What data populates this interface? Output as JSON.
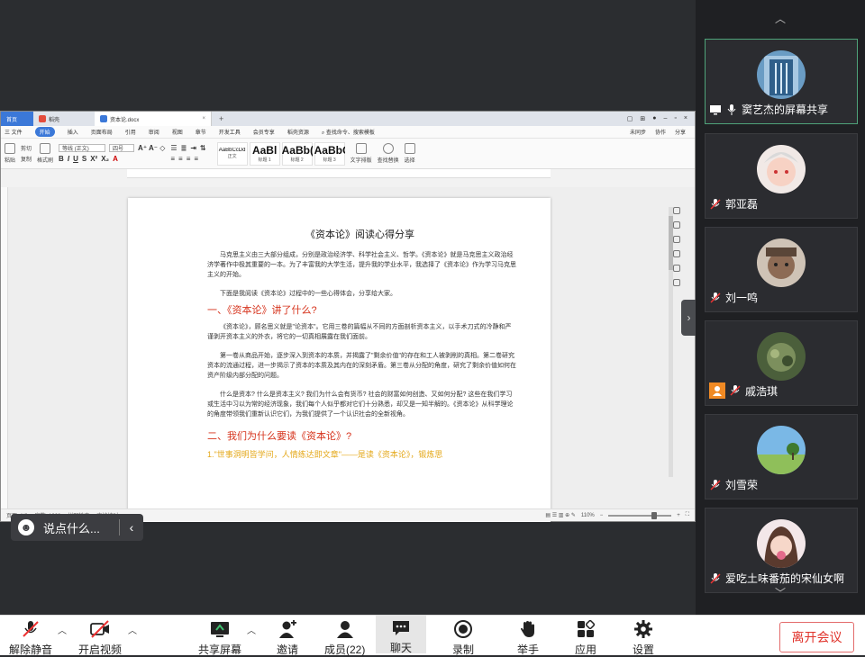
{
  "wps": {
    "tab_home": "首页",
    "tab_docer": "稻壳",
    "tab_doc": "资本论.docx",
    "menu": [
      "三 文件",
      "开始",
      "插入",
      "页面布局",
      "引用",
      "审阅",
      "视图",
      "章节",
      "开发工具",
      "会员专享",
      "稻壳资源"
    ],
    "menu_search": "查找命令、搜索模板",
    "menu_right": [
      "未同步",
      "协作",
      "分享"
    ],
    "ribbon": {
      "paste": "粘贴",
      "cut": "剪切",
      "copy": "复制",
      "format_painter": "格式刷",
      "font_name": "等线 (正文)",
      "font_size": "四号",
      "styles": [
        {
          "big": "AaBbCcDd",
          "label": "正文"
        },
        {
          "big": "AaBl",
          "label": "标题 1"
        },
        {
          "big": "AaBb(",
          "label": "标题 2"
        },
        {
          "big": "AaBbC",
          "label": "标题 3"
        }
      ],
      "text_layout": "文字排版",
      "find_replace": "查找替换",
      "select": "选择"
    },
    "doc": {
      "title": "《资本论》阅读心得分享",
      "p1": "马克思主义由三大部分组成，分别是政治经济学、科学社会主义、哲学。《资本论》就是马克思主义政治经济学著作中极其重要的一本。为了丰富我的大学生活，提升我的学业水平，我选择了《资本论》作为学习马克思主义的开始。",
      "p2": "下面是我阅读《资本论》过程中的一些心得体会，分享给大家。",
      "h1": "一、《资本论》讲了什么?",
      "p3": "《资本论》，顾名思义就是\"论资本\"。它用三卷的篇幅从不同的方面剖析资本主义，以手术刀式的冷静和严谨剥开资本主义的外衣，将它的一切真相展露在我们面前。",
      "p4": "第一卷从商品开始，逐步深入到资本的本质，并揭露了\"剩余价值\"的存在和工人被剥削的真相。第二卷研究资本的流通过程，进一步揭示了资本的本质及其内在的深刻矛盾。第三卷从分配的角度，研究了剩余价值如何在资产阶级内部分配的问题。",
      "p5": "什么是资本? 什么是资本主义? 我们为什么会有货币? 社会的财富如何创造、又如何分配? 这些在我们学习或生活中习以为常的经济现象，我们每个人似乎都对它们十分熟悉，却又是一知半解的。《资本论》从科学理论的角度带领我们重新认识它们，为我们提供了一个认识社会的全新视角。",
      "h2": "二、我们为什么要读《资本论》?",
      "h3": "1.\"世事洞明皆学问，人情练达即文章\"——是读《资本论》，锻炼思"
    },
    "status": {
      "page": "页面: 1/3",
      "words": "字数: 1008",
      "spell": "拼写检查",
      "proof": "文档校对",
      "zoom": "110%"
    }
  },
  "chat_placeholder": "说点什么...",
  "participants": [
    {
      "name": "窦艺杰的屏幕共享",
      "mic": "on",
      "active": true
    },
    {
      "name": "郭亚磊",
      "mic": "muted",
      "active": false
    },
    {
      "name": "刘一鸣",
      "mic": "muted",
      "active": false
    },
    {
      "name": "戚浩琪",
      "mic": "muted",
      "active": false,
      "host": true
    },
    {
      "name": "刘雪荣",
      "mic": "muted",
      "active": false
    },
    {
      "name": "爱吃土味番茄的宋仙女啊",
      "mic": "muted",
      "active": false
    }
  ],
  "toolbar": {
    "unmute": "解除静音",
    "video": "开启视频",
    "share": "共享屏幕",
    "invite": "邀请",
    "members": "成员(22)",
    "chat": "聊天",
    "record": "录制",
    "raise": "举手",
    "apps": "应用",
    "settings": "设置",
    "leave": "离开会议"
  },
  "colors": {
    "accent_blue": "#3b78d8",
    "heading_red": "#d6321b",
    "heading_orange": "#e4a81a",
    "active_tile": "#4fa37a",
    "leave_red": "#e0332b"
  }
}
